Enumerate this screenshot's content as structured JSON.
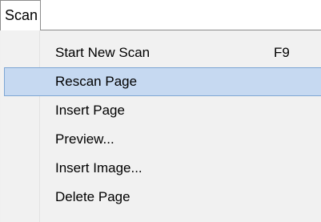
{
  "menubar": {
    "scan_label": "Scan"
  },
  "menu": {
    "items": [
      {
        "label": "Start New Scan",
        "shortcut": "F9"
      },
      {
        "label": "Rescan Page",
        "shortcut": ""
      },
      {
        "label": "Insert Page",
        "shortcut": ""
      },
      {
        "label": "Preview...",
        "shortcut": ""
      },
      {
        "label": "Insert Image...",
        "shortcut": ""
      },
      {
        "label": "Delete Page",
        "shortcut": ""
      }
    ],
    "highlighted_item": "Rescan Page"
  },
  "colors": {
    "highlight_fill": "#c6d9f1",
    "highlight_border": "#7ea6d4",
    "menu_background": "#f1f1f1"
  }
}
